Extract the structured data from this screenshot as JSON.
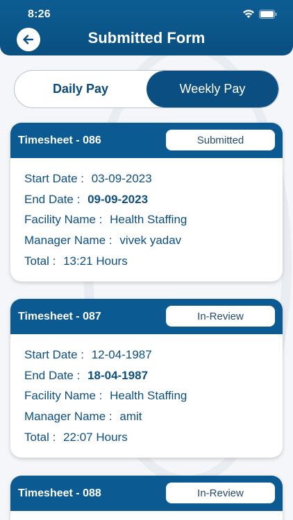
{
  "status_bar": {
    "time": "8:26"
  },
  "header": {
    "title": "Submitted Form"
  },
  "tabs": [
    {
      "label": "Daily Pay",
      "selected": false
    },
    {
      "label": "Weekly Pay",
      "selected": true
    }
  ],
  "timesheets": [
    {
      "title": "Timesheet - 086",
      "status": "Submitted",
      "start_label": "Start Date :",
      "start": "03-09-2023",
      "end_label": "End Date :",
      "end": "09-09-2023",
      "facility_label": "Facility Name :",
      "facility": "Health Staffing",
      "manager_label": "Manager Name :",
      "manager": "vivek yadav",
      "total_label": "Total :",
      "total": "13:21 Hours"
    },
    {
      "title": "Timesheet - 087",
      "status": "In-Review",
      "start_label": "Start Date :",
      "start": "12-04-1987",
      "end_label": "End Date :",
      "end": "18-04-1987",
      "facility_label": "Facility Name :",
      "facility": "Health Staffing",
      "manager_label": "Manager Name :",
      "manager": "amit",
      "total_label": "Total :",
      "total": "22:07 Hours"
    },
    {
      "title": "Timesheet - 088",
      "status": "In-Review"
    }
  ],
  "colors": {
    "primary": "#0b5b92",
    "text": "#0d4f80",
    "background": "#f4f6f9"
  }
}
